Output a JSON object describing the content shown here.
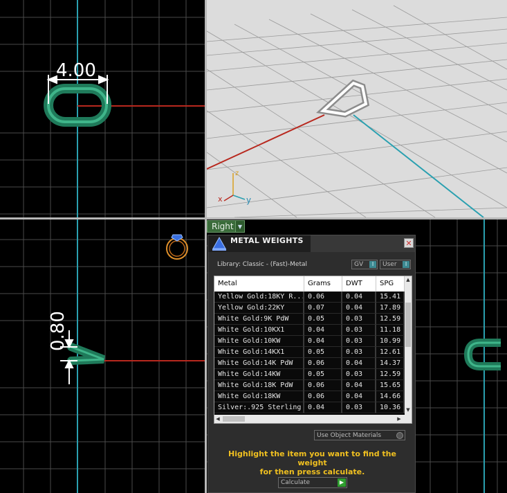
{
  "viewports": {
    "top": {
      "dimension_label": "4.00"
    },
    "perspective": {
      "axis_x": "x",
      "axis_y": "y",
      "axis_z": "z"
    },
    "front": {
      "dimension_label": "0.80"
    },
    "right": {
      "label": "Right"
    }
  },
  "dialog": {
    "title": "METAL WEIGHTS",
    "library_label": "Library: Classic - (Fast)-Metal",
    "toggles": [
      {
        "label": "GV",
        "indicator": "I"
      },
      {
        "label": "User",
        "indicator": "I"
      }
    ],
    "table": {
      "columns": [
        "Metal",
        "Grams",
        "DWT",
        "SPG"
      ],
      "rows": [
        [
          "Yellow Gold:18KY R...",
          "0.06",
          "0.04",
          "15.41"
        ],
        [
          "Yellow Gold:22KY",
          "0.07",
          "0.04",
          "17.89"
        ],
        [
          "White Gold:9K PdW",
          "0.05",
          "0.03",
          "12.59"
        ],
        [
          "White Gold:10KX1",
          "0.04",
          "0.03",
          "11.18"
        ],
        [
          "White Gold:10KW",
          "0.04",
          "0.03",
          "10.99"
        ],
        [
          "White Gold:14KX1",
          "0.05",
          "0.03",
          "12.61"
        ],
        [
          "White Gold:14K PdW",
          "0.06",
          "0.04",
          "14.37"
        ],
        [
          "White Gold:14KW",
          "0.05",
          "0.03",
          "12.59"
        ],
        [
          "White Gold:18K PdW",
          "0.06",
          "0.04",
          "15.65"
        ],
        [
          "White Gold:18KW",
          "0.06",
          "0.04",
          "14.66"
        ],
        [
          "Silver:.925 Sterling",
          "0.04",
          "0.03",
          "10.36"
        ]
      ]
    },
    "use_object_materials": "Use Object Materials",
    "hint_line1": "Highlight the item you want to find the weight",
    "hint_line2": "for then press calculate.",
    "calculate_label": "Calculate",
    "colors": {
      "hint": "#f0c020",
      "accent": "#3d8a93",
      "go": "#2f9e2f"
    }
  }
}
